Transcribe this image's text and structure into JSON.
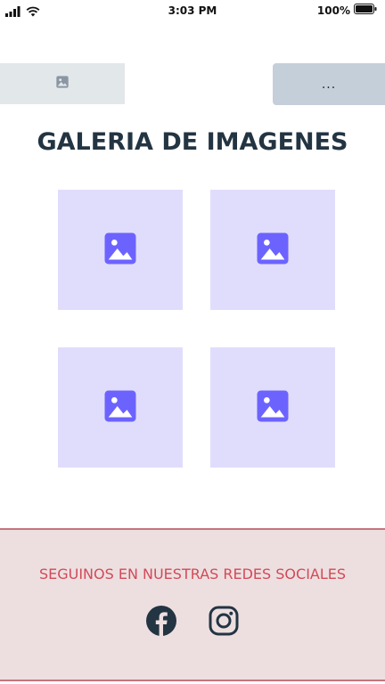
{
  "status_bar": {
    "time": "3:03 PM",
    "battery_percent": "100%",
    "signal_icon": "cellular-signal-icon",
    "wifi_icon": "wifi-icon",
    "battery_icon": "battery-full-icon"
  },
  "header": {
    "logo_icon": "image-placeholder-icon",
    "menu_label": "..."
  },
  "main": {
    "title": "GALERIA DE IMAGENES",
    "gallery": [
      {
        "icon": "image-placeholder-icon"
      },
      {
        "icon": "image-placeholder-icon"
      },
      {
        "icon": "image-placeholder-icon"
      },
      {
        "icon": "image-placeholder-icon"
      }
    ]
  },
  "footer": {
    "text": "SEGUINOS EN NUESTRAS REDES SOCIALES",
    "social": [
      {
        "icon": "facebook-icon"
      },
      {
        "icon": "instagram-icon"
      }
    ]
  },
  "colors": {
    "title": "#233442",
    "tile_bg": "#e0ddfc",
    "tile_icon": "#6c63ff",
    "footer_bg": "#eddfe0",
    "footer_border": "#c4757c",
    "footer_text": "#d24a58",
    "menu_button_bg": "#c4cfd9",
    "logo_box_bg": "#e2e7ea"
  }
}
